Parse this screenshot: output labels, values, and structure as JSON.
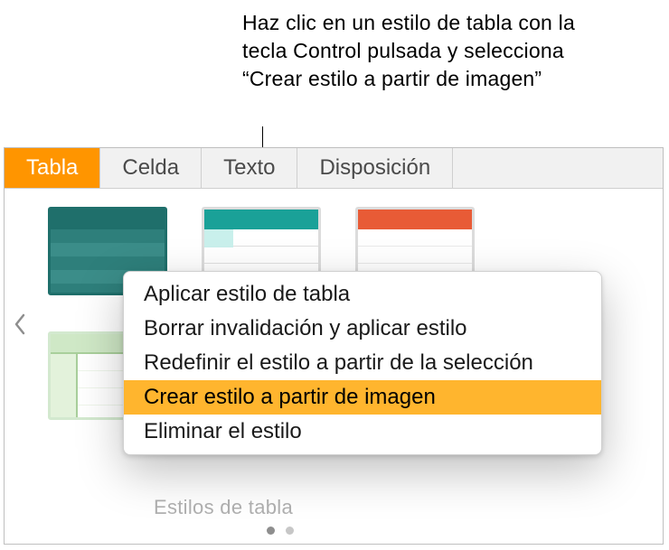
{
  "callout": "Haz clic en un estilo de tabla con la tecla Control pulsada y selecciona “Crear estilo a partir de imagen”",
  "tabs": {
    "tabla": "Tabla",
    "celda": "Celda",
    "texto": "Texto",
    "disposicion": "Disposición"
  },
  "styles_label": "Estilos de tabla",
  "context_menu": {
    "apply": "Aplicar estilo de tabla",
    "clear": "Borrar invalidación y aplicar estilo",
    "redefine": "Redefinir el estilo a partir de la selección",
    "create_from_image": "Crear estilo a partir de imagen",
    "delete": "Eliminar el estilo"
  },
  "colors": {
    "accent_active_tab": "#ff9500",
    "menu_highlight": "#ffb52e"
  }
}
